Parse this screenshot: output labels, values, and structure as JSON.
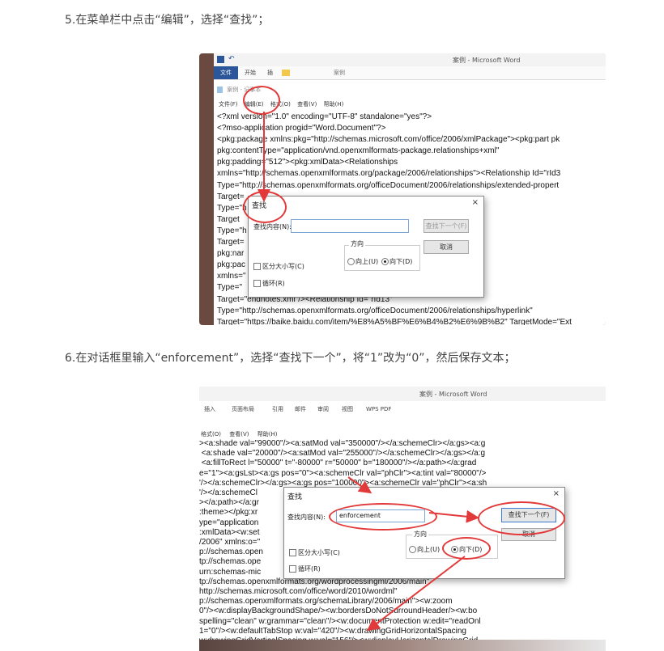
{
  "steps": [
    {
      "text": "5.在菜单栏中点击“编辑”，选择“查找”；"
    },
    {
      "text": "6.在对话框里输入“enforcement”，选择“查找下一个”，将“1”改为“0”，然后保存文本；"
    }
  ],
  "shot1": {
    "window_title": "案例 - Microsoft Word",
    "ribbon_tabs": [
      "文件",
      "开始",
      "插"
    ],
    "quick_path": "案例",
    "notepad_title": "案例 - 记事本",
    "menu": [
      "文件(F)",
      "编辑(E)",
      "格式(O)",
      "查看(V)",
      "帮助(H)"
    ],
    "code_lines": [
      "<?xml version=\"1.0\" encoding=\"UTF-8\" standalone=\"yes\"?>",
      "<?mso-application progid=\"Word.Document\"?>",
      "<pkg:package xmlns:pkg=\"http://schemas.microsoft.com/office/2006/xmlPackage\"><pkg:part pk",
      "pkg:contentType=\"application/vnd.openxmlformats-package.relationships+xml\"",
      "pkg:padding=\"512\"><pkg:xmlData><Relationships",
      "xmlns=\"http://schemas.openxmlformats.org/package/2006/relationships\"><Relationship Id=\"rId3",
      "Type=\"http://schemas.openxmlformats.org/officeDocument/2006/relationships/extended-propert",
      "Target=",
      "Type=\"h                                                 onships/metadata/core-propertie",
      "Target",
      "Type=\"h                                                06/relationships/officeDocument\"",
      "Target=                                                 a></pkg:part><pkg:part",
      "pkg:nar                                                 application/vnd.openxmlformats-p",
      "pkg:pac",
      "xmlns=\"                                                 ationships\"><Relationship Id=\"rId8",
      "Type=\"                                                  06/relationships/endnotes\"",
      "Target=\"endnotes.xml\"/><Relationship Id=\"rId13\"",
      "Type=\"http://schemas.openxmlformats.org/officeDocument/2006/relationships/hyperlink\"",
      "Target=\"https://baike.baidu.com/item/%E8%A5%BF%E6%B4%B2%E6%9B%B2\" TargetMode=\"Ext"
    ],
    "dialog": {
      "title": "查找",
      "find_label": "查找内容(N):",
      "find_value": "",
      "find_next": "查找下一个(F)",
      "cancel": "取消",
      "direction_label": "方向",
      "up": "向上(U)",
      "down": "向下(D)",
      "match_case": "区分大小写(C)",
      "wrap": "循环(R)",
      "close": "×"
    }
  },
  "shot2": {
    "window_title": "案例 - Microsoft Word",
    "ribbon_tabs": [
      "插入",
      "页面布局",
      "引用",
      "邮件",
      "审阅",
      "视图",
      "WPS PDF"
    ],
    "menu": [
      "格式(O)",
      "查看(V)",
      "帮助(H)"
    ],
    "code_lines": [
      "><a:shade val=\"99000\"/><a:satMod val=\"350000\"/></a:schemeClr></a:gs><a:g",
      " <a:shade val=\"20000\"/><a:satMod val=\"255000\"/></a:schemeClr></a:gs></a:g",
      " <a:fillToRect l=\"50000\" t=\"-80000\" r=\"50000\" b=\"180000\"/></a:path></a:grad",
      "e=\"1\"><a:gsLst><a:gs pos=\"0\"><a:schemeClr val=\"phClr\"><a:tint val=\"80000\"/>",
      "'/></a:schemeClr></a:gs><a:gs pos=\"100000\"><a:schemeClr val=\"phClr\"><a:sh",
      "'/></a:schemeCl                                                       l=\"5000",
      "></a:path></a:gr                                                 ments><",
      ":theme></pkg:xr                                                 gs.xml\"",
      "ype=\"application                                                al.setting",
      ":xmlData><w:set                                                  openxmlfo",
      "/2006\" xmlns:o=\"",
      "p://schemas.open",
      "tp://schemas.ope                                                 \"urn:sch",
      "urn:schemas-mic",
      "tp://schemas.openxmlformats.org/wordprocessingml/2006/main\"",
      "http://schemas.microsoft.com/office/word/2010/wordml\"",
      "p://schemas.openxmlformats.org/schemaLibrary/2006/main\"><w:zoom",
      "0\"/><w:displayBackgroundShape/><w:bordersDoNotSurroundHeader/><w:bo",
      "spelling=\"clean\" w:grammar=\"clean\"/><w:documentProtection w:edit=\"readOnl",
      "1=\"0\"/><w:defaultTabStop w:val=\"420\"/><w:drawingGridHorizontalSpacing",
      "w:drawingGridVerticalSpacing w:val=\"156\"/><w:displayHorizontalDrawingGrid"
    ],
    "dialog": {
      "title": "查找",
      "find_label": "查找内容(N):",
      "find_value": "enforcement",
      "find_next": "查找下一个(F)",
      "cancel": "取消",
      "direction_label": "方向",
      "up": "向上(U)",
      "down": "向下(D)",
      "match_case": "区分大小写(C)",
      "wrap": "循环(R)",
      "close": "×"
    }
  },
  "colors": {
    "accent": "#e23a3a",
    "word_blue": "#2b579a"
  }
}
